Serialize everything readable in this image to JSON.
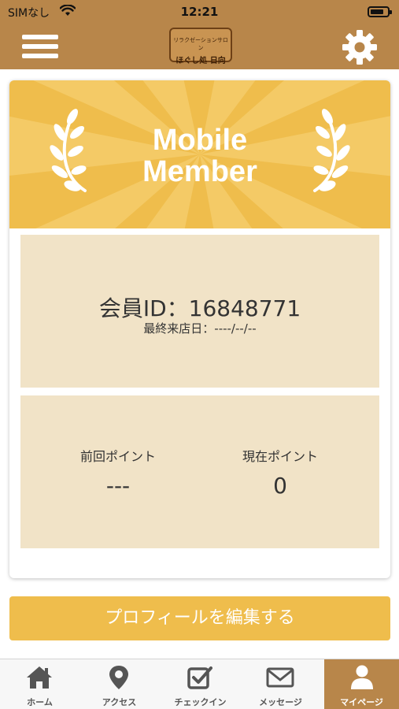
{
  "status_bar": {
    "carrier": "SIMなし",
    "time": "12:21"
  },
  "header": {
    "logo_line1": "リラクゼーションサロン",
    "logo_line2": "ほぐし処 日向",
    "menu_icon": "hamburger-icon",
    "settings_icon": "gear-icon"
  },
  "member_card": {
    "title_line1": "Mobile",
    "title_line2": "Member",
    "member_id": "会員ID：16848771",
    "last_visit": "最終来店日：----/--/--",
    "previous_points_label": "前回ポイント",
    "previous_points_value": "---",
    "current_points_label": "現在ポイント",
    "current_points_value": "0"
  },
  "edit_profile_button": "プロフィールを編集する",
  "tabs": [
    {
      "label": "ホーム",
      "icon": "home-icon"
    },
    {
      "label": "アクセス",
      "icon": "map-pin-icon"
    },
    {
      "label": "チェックイン",
      "icon": "checkbox-icon"
    },
    {
      "label": "メッセージ",
      "icon": "envelope-icon"
    },
    {
      "label": "マイページ",
      "icon": "person-icon",
      "active": true
    }
  ],
  "colors": {
    "brand_brown": "#b8864a",
    "banner_gold": "#efbd4c",
    "panel_beige": "#f1e3c7"
  }
}
